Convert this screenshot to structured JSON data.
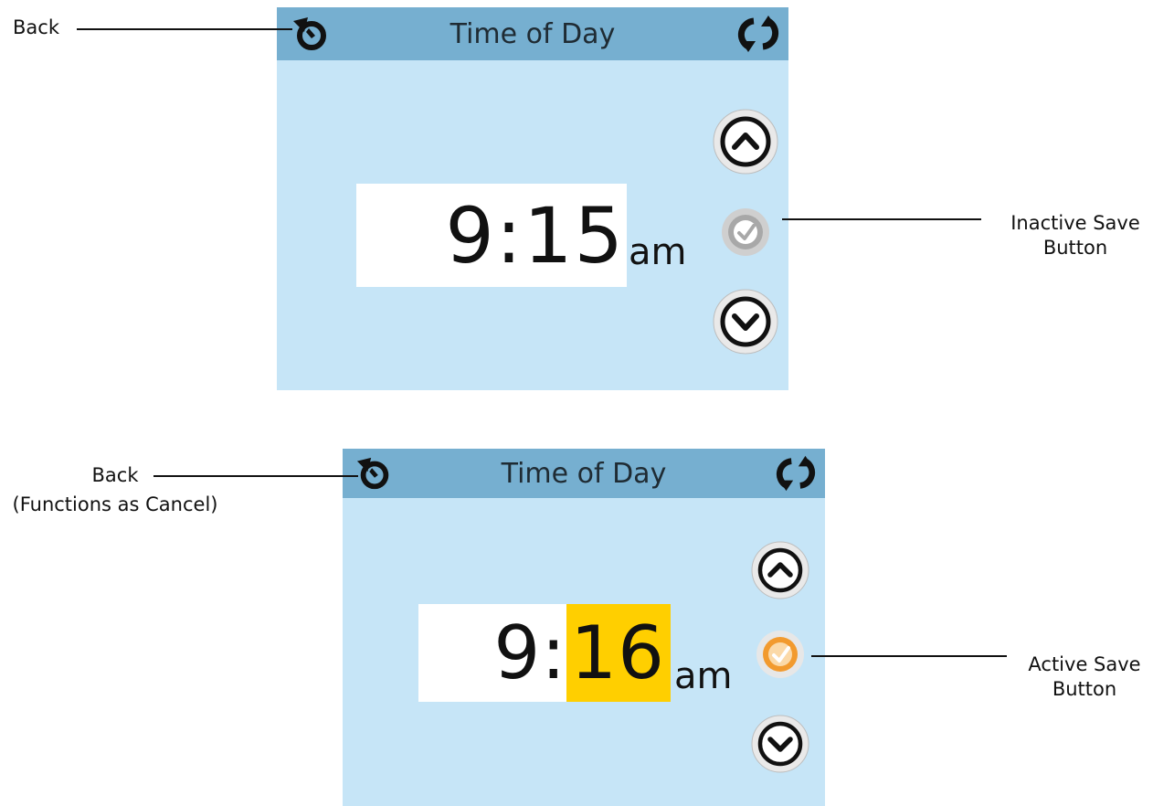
{
  "panels": [
    {
      "title": "Time of Day",
      "time": "9:15",
      "ampm": "am",
      "save_state": "inactive"
    },
    {
      "title": "Time of Day",
      "time_hour": "9:",
      "time_minute": "16",
      "ampm": "am",
      "save_state": "active"
    }
  ],
  "callouts": {
    "back_top": "Back",
    "inactive_save_line1": "Inactive Save",
    "inactive_save_line2": "Button",
    "back_bottom": "Back",
    "back_bottom_note": "(Functions as Cancel)",
    "active_save_line1": "Active Save",
    "active_save_line2": "Button"
  },
  "icons": {
    "back": "back-icon",
    "refresh": "refresh-icon",
    "up": "chevron-up-icon",
    "down": "chevron-down-icon",
    "save": "checkmark-icon"
  },
  "colors": {
    "screen_bg": "#c6e5f7",
    "titlebar_bg": "#76afd0",
    "highlight": "#ffcf00",
    "active_save": "#f29a2e",
    "inactive_save": "#a8a8a8"
  }
}
